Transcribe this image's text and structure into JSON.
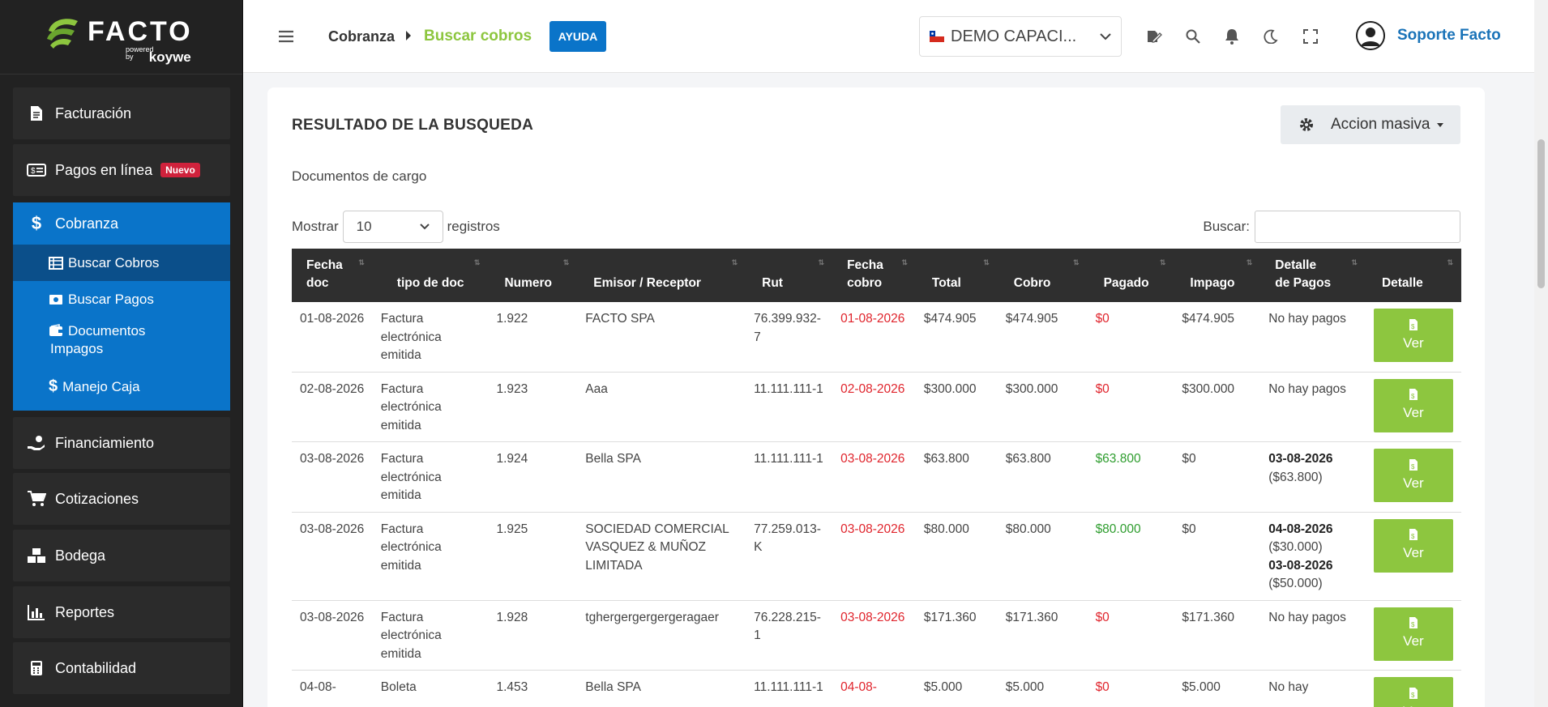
{
  "brand": {
    "name": "FACTO",
    "powered_by": "powered by",
    "partner": "koywe"
  },
  "sidebar": {
    "items": [
      {
        "label": "Facturación",
        "icon": "document-icon"
      },
      {
        "label": "Pagos en línea",
        "icon": "money-card-icon",
        "badge": "Nuevo"
      },
      {
        "label": "Cobranza",
        "icon": "dollar-icon"
      },
      {
        "label": "Financiamiento",
        "icon": "hand-coin-icon"
      },
      {
        "label": "Cotizaciones",
        "icon": "cart-icon"
      },
      {
        "label": "Bodega",
        "icon": "boxes-icon"
      },
      {
        "label": "Reportes",
        "icon": "chart-icon"
      },
      {
        "label": "Contabilidad",
        "icon": "calculator-icon"
      }
    ],
    "cobranza_sub": [
      {
        "label": "Buscar Cobros",
        "icon": "table-icon"
      },
      {
        "label": "Buscar Pagos",
        "icon": "money-icon"
      },
      {
        "label": "Documentos Impagos",
        "icon": "wallet-icon"
      },
      {
        "label": "Manejo Caja",
        "icon": "dollar-icon"
      }
    ]
  },
  "header": {
    "breadcrumb_parent": "Cobranza",
    "breadcrumb_current": "Buscar cobros",
    "help_label": "AYUDA",
    "company": "DEMO CAPACI...",
    "user_name": "Soporte Facto"
  },
  "main": {
    "title": "RESULTADO DE LA BUSQUEDA",
    "bulk_action": "Accion masiva",
    "subtitle": "Documentos de cargo",
    "show_label": "Mostrar",
    "show_value": "10",
    "records_label": "registros",
    "search_label": "Buscar:",
    "view_label": "Ver"
  },
  "table": {
    "headers": [
      [
        "Fecha",
        "doc"
      ],
      [
        "tipo de doc"
      ],
      [
        "Numero"
      ],
      [
        "Emisor / Receptor"
      ],
      [
        "Rut"
      ],
      [
        "Fecha",
        "cobro"
      ],
      [
        "Total"
      ],
      [
        "Cobro"
      ],
      [
        "Pagado"
      ],
      [
        "Impago"
      ],
      [
        "Detalle",
        "de Pagos"
      ],
      [
        "Detalle"
      ]
    ],
    "rows": [
      {
        "fecha_doc": "01-08-2026",
        "tipo": "Factura electrónica emitida",
        "numero": "1.922",
        "emisor": "FACTO SPA",
        "rut": "76.399.932-7",
        "fecha_cobro": "01-08-2026",
        "total": "$474.905",
        "cobro": "$474.905",
        "pagado": "$0",
        "pagado_status": "red",
        "impago": "$474.905",
        "detalle": [
          {
            "text": "No hay pagos",
            "bold": false
          }
        ]
      },
      {
        "fecha_doc": "02-08-2026",
        "tipo": "Factura electrónica emitida",
        "numero": "1.923",
        "emisor": "Aaa",
        "rut": "11.111.111-1",
        "fecha_cobro": "02-08-2026",
        "total": "$300.000",
        "cobro": "$300.000",
        "pagado": "$0",
        "pagado_status": "red",
        "impago": "$300.000",
        "detalle": [
          {
            "text": "No hay pagos",
            "bold": false
          }
        ]
      },
      {
        "fecha_doc": "03-08-2026",
        "tipo": "Factura electrónica emitida",
        "numero": "1.924",
        "emisor": "Bella SPA",
        "rut": "11.111.111-1",
        "fecha_cobro": "03-08-2026",
        "total": "$63.800",
        "cobro": "$63.800",
        "pagado": "$63.800",
        "pagado_status": "green",
        "impago": "$0",
        "detalle": [
          {
            "text": "03-08-2026",
            "bold": true
          },
          {
            "text": "($63.800)",
            "bold": false
          }
        ]
      },
      {
        "fecha_doc": "03-08-2026",
        "tipo": "Factura electrónica emitida",
        "numero": "1.925",
        "emisor": "SOCIEDAD COMERCIAL VASQUEZ & MUÑOZ LIMITADA",
        "rut": "77.259.013-K",
        "fecha_cobro": "03-08-2026",
        "total": "$80.000",
        "cobro": "$80.000",
        "pagado": "$80.000",
        "pagado_status": "green",
        "impago": "$0",
        "detalle": [
          {
            "text": "04-08-2026",
            "bold": true
          },
          {
            "text": "($30.000)",
            "bold": false
          },
          {
            "text": "03-08-2026",
            "bold": true
          },
          {
            "text": "($50.000)",
            "bold": false
          }
        ]
      },
      {
        "fecha_doc": "03-08-2026",
        "tipo": "Factura electrónica emitida",
        "numero": "1.928",
        "emisor": "tghergergergergeragaer",
        "rut": "76.228.215-1",
        "fecha_cobro": "03-08-2026",
        "total": "$171.360",
        "cobro": "$171.360",
        "pagado": "$0",
        "pagado_status": "red",
        "impago": "$171.360",
        "detalle": [
          {
            "text": "No hay pagos",
            "bold": false
          }
        ]
      },
      {
        "fecha_doc": "04-08-",
        "tipo": "Boleta",
        "numero": "1.453",
        "emisor": "Bella SPA",
        "rut": "11.111.111-1",
        "fecha_cobro": "04-08-",
        "total": "$5.000",
        "cobro": "$5.000",
        "pagado": "$0",
        "pagado_status": "red",
        "impago": "$5.000",
        "detalle": [
          {
            "text": "No hay",
            "bold": false
          }
        ]
      }
    ]
  },
  "colors": {
    "accent_green": "#8dc63f",
    "primary_blue": "#0a74c9",
    "sidebar_bg": "#222222",
    "header_bg": "#2f2f2f",
    "danger_red": "#e0242c",
    "success_green": "#2e9d2e"
  }
}
